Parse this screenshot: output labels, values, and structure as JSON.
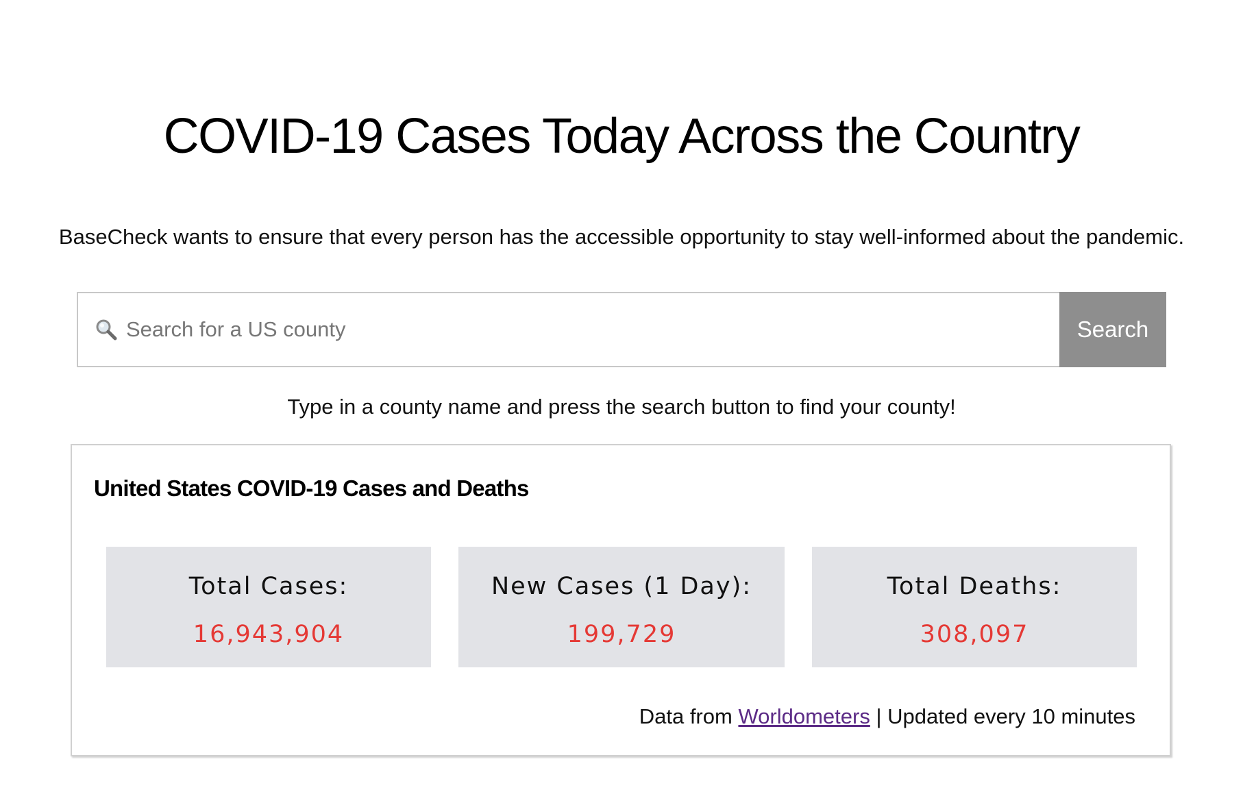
{
  "header": {
    "title": "COVID-19 Cases Today Across the Country",
    "intro": "BaseCheck wants to ensure that every person has the accessible opportunity to stay well-informed about the pandemic."
  },
  "search": {
    "icon": "magnifying-glass",
    "placeholder": "Search for a US county",
    "value": "",
    "button_label": "Search",
    "hint": "Type in a county name and press the search button to find your county!"
  },
  "stats_card": {
    "title": "United States COVID-19 Cases and Deaths",
    "value_color": "#e53935",
    "tiles": [
      {
        "label": "Total Cases:",
        "value": "16,943,904"
      },
      {
        "label": "New Cases (1 Day):",
        "value": "199,729"
      },
      {
        "label": "Total Deaths:",
        "value": "308,097"
      }
    ],
    "source": {
      "prefix": "Data from",
      "link_text": "Worldometers",
      "suffix": "| Updated every 10 minutes"
    }
  },
  "colors": {
    "search_button_bg": "#8e8e8e",
    "tile_bg": "#e2e3e7",
    "link": "#5b2a86"
  }
}
